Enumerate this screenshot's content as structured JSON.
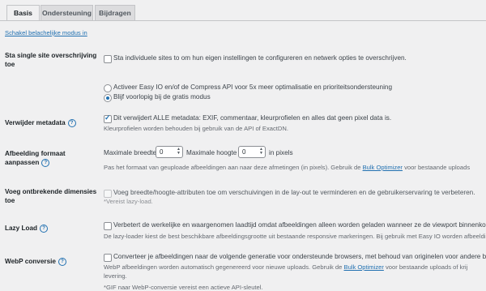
{
  "tabs": [
    {
      "label": "Basis",
      "active": true
    },
    {
      "label": "Ondersteuning",
      "active": false
    },
    {
      "label": "Bijdragen",
      "active": false
    }
  ],
  "easy_mode_link": "Schakel belachelijke modus in",
  "single_site": {
    "title_line1": "Sta single site overschrijving",
    "title_line2": "toe",
    "checkbox_label": "Sta individuele sites to om hun eigen instellingen te configureren en netwerk opties te overschrijven.",
    "checked": false
  },
  "compress_options": {
    "option1": "Activeer Easy IO en/of de Compress API voor 5x meer optimalisatie en prioriteitsondersteuning",
    "option2": "Blijf voorlopig bij de gratis modus",
    "selected": "option2"
  },
  "metadata": {
    "title": "Verwijder metadata",
    "checkbox_label": "Dit verwijdert ALLE metadata: EXIF, commentaar, kleurprofielen en alles dat geen pixel data is.",
    "desc": "Kleurprofielen worden behouden bij gebruik van de API of ExactDN.",
    "checked": true
  },
  "resize": {
    "title_line1": "Afbeelding formaat",
    "title_line2": "aanpassen",
    "width_label": "Maximale breedte",
    "width_value": "0",
    "height_label": "Maximale hoogte",
    "height_value": "0",
    "unit": "in pixels",
    "desc_pre": "Pas het formaat van geuploade afbeeldingen aan naar deze afmetingen (in pixels). Gebruik de ",
    "desc_link": "Bulk Optimizer",
    "desc_post": " voor bestaande uploads"
  },
  "dimensions": {
    "title_line1": "Voeg ontbrekende dimensies",
    "title_line2": "toe",
    "checkbox_label": "Voeg breedte/hoogte-attributen toe om verschuivingen in de lay-out te verminderen en de gebruikerservaring te verbeteren.",
    "desc": "*Vereist lazy-load.",
    "checked": false
  },
  "lazy_load": {
    "title": "Lazy Load",
    "checkbox_label": "Verbetert de werkelijke en waargenomen laadtijd omdat afbeeldingen alleen worden geladen wanneer ze de viewport binnenkome",
    "desc": "De lazy-loader kiest de best beschikbare afbeeldingsgrootte uit bestaande responsive markeringen. Bij gebruik met Easy IO worden afbeelding",
    "checked": false
  },
  "webp": {
    "title": "WebP conversie",
    "checkbox_label": "Converteer je afbeeldingen naar de volgende generatie voor ondersteunde browsers, met behoud van originelen voor andere brow",
    "desc_pre": "WebP afbeeldingen worden automatisch gegenereerd voor nieuwe uploads. Gebruik de ",
    "desc_link": "Bulk Optimizer",
    "desc_post": " voor bestaande uploads of krij",
    "desc_line2": "levering.",
    "desc_line3": "*GIF naar WebP-conversie vereist een actieve API-sleutel.",
    "checked": false
  },
  "icons": {
    "help": "help-circle-icon",
    "check": "checkmark-icon"
  },
  "colors": {
    "link": "#2271b1",
    "background": "#f0f0f1"
  }
}
